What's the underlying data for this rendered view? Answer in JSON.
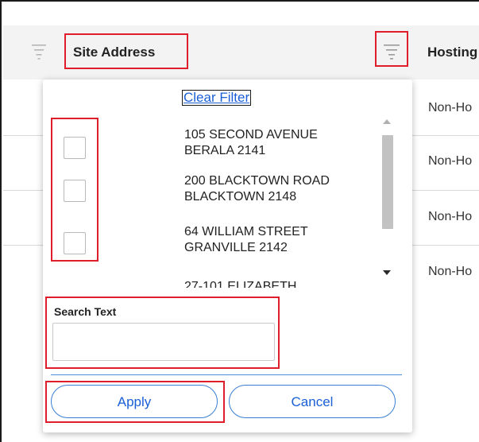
{
  "table": {
    "columns": [
      {
        "label": "Site Address"
      },
      {
        "label": "Hosting"
      }
    ],
    "hosting_values": [
      "Non-Ho",
      "Non-Ho",
      "Non-Ho",
      "Non-Ho"
    ]
  },
  "filter_popup": {
    "clear_filter_label": "Clear Filter",
    "options": [
      {
        "line1": "105 SECOND AVENUE",
        "line2": "BERALA 2141",
        "checked": false
      },
      {
        "line1": "200 BLACKTOWN ROAD",
        "line2": "BLACKTOWN 2148",
        "checked": false
      },
      {
        "line1": "64 WILLIAM STREET",
        "line2": "GRANVILLE 2142",
        "checked": false
      },
      {
        "line1": "27-101 ELIZABETH",
        "line2": "",
        "checked": false
      }
    ],
    "search_label": "Search Text",
    "search_value": "",
    "apply_label": "Apply",
    "cancel_label": "Cancel"
  },
  "colors": {
    "highlight": "#e01d2a",
    "accent": "#1a5fd6",
    "header_bg": "#f3f3f4"
  },
  "icons": {
    "column_filter": "filter-lines-icon"
  }
}
